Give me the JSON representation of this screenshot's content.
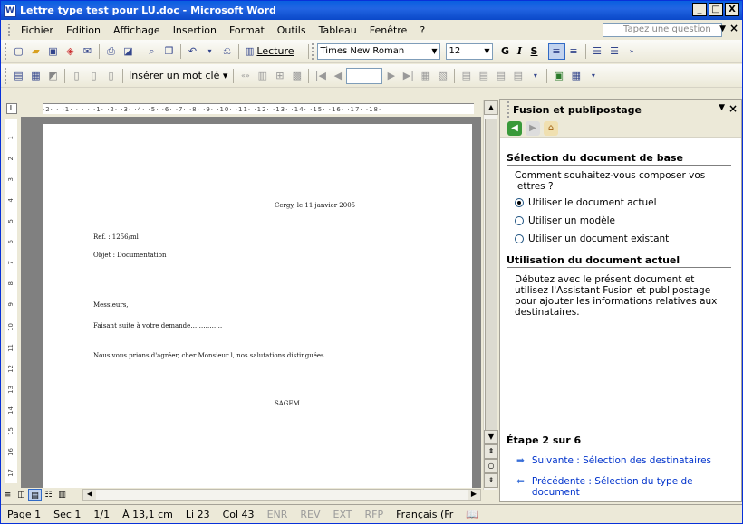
{
  "title": "Lettre type test pour LU.doc - Microsoft Word",
  "window_buttons": [
    "_",
    "□",
    "X"
  ],
  "menu": [
    "Fichier",
    "Edition",
    "Affichage",
    "Insertion",
    "Format",
    "Outils",
    "Tableau",
    "Fenêtre",
    "?"
  ],
  "question_placeholder": "Tapez une question",
  "toolbar1": {
    "lecture": "Lecture",
    "font": "Times New Roman",
    "size": "12",
    "bold": "G",
    "italic": "I",
    "underline": "S"
  },
  "toolbar2": {
    "insert_field": "Insérer un mot clé ▾"
  },
  "ruler_text": "·2·  ·  ·1·  ·  ·  ·  ·1·  ·2·  ·3·  ·4·  ·5·  ·6·  ·7·  ·8·  ·9·  ·10·  ·11·  ·12·  ·13·  ·14·  ·15·  ·16·  ·17·  ·18·",
  "vruler": [
    "1",
    "2",
    "3",
    "4",
    "5",
    "6",
    "7",
    "8",
    "9",
    "10",
    "11",
    "12",
    "13",
    "14",
    "15",
    "16",
    "17"
  ],
  "document": {
    "date": "Cergy, le 11 janvier 2005",
    "ref": "Ref. : 1256/ml",
    "objet": "Objet : Documentation",
    "salutation": "Messieurs,",
    "line1": "Faisant suite à votre demande……………",
    "line2": "Nous vous prions d'agréer, cher Monsieur l, nos salutations distinguées.",
    "signature": "SAGEM"
  },
  "pane": {
    "title": "Fusion et publipostage",
    "section1": "Sélection du document de base",
    "question": "Comment souhaitez-vous composer vos lettres ?",
    "options": [
      "Utiliser le document actuel",
      "Utiliser un modèle",
      "Utiliser un document existant"
    ],
    "selected": 0,
    "section2": "Utilisation du document actuel",
    "description": "Débutez avec le présent document et utilisez l'Assistant Fusion et publipostage pour ajouter les informations relatives aux destinataires.",
    "step": "Étape 2 sur 6",
    "next": "Suivante : Sélection des destinataires",
    "prev": "Précédente : Sélection du type de document"
  },
  "status": {
    "page": "Page 1",
    "sec": "Sec 1",
    "pages": "1/1",
    "pos": "À 13,1 cm",
    "line": "Li 23",
    "col": "Col 43",
    "enr": "ENR",
    "rev": "REV",
    "ext": "EXT",
    "rfp": "RFP",
    "lang": "Français (Fr"
  }
}
